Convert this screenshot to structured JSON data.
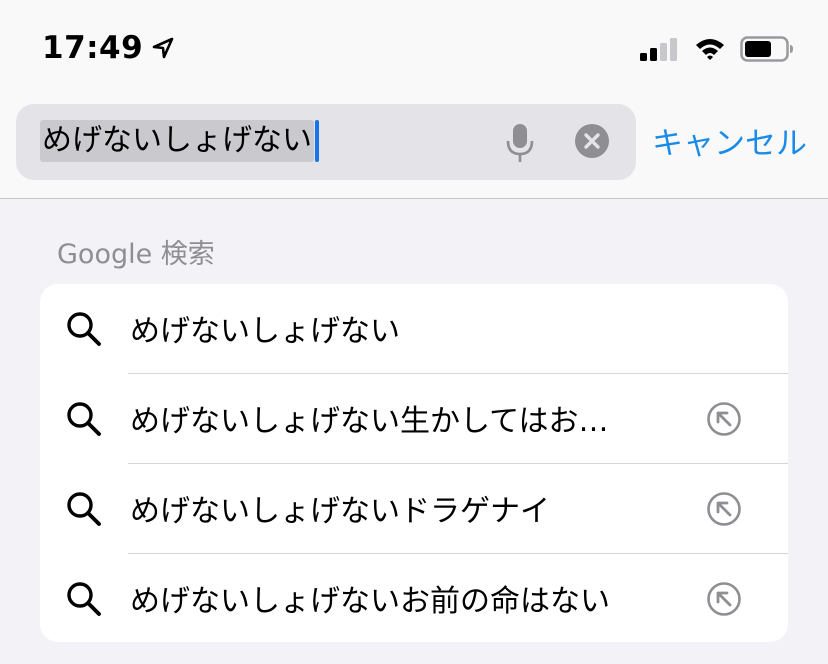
{
  "status_bar": {
    "time": "17:49"
  },
  "search": {
    "query": "めげないしょげない",
    "cancel_label": "キャンセル"
  },
  "results": {
    "section_title": "Google 検索",
    "items": [
      {
        "label": "めげないしょげない",
        "has_fill_arrow": false
      },
      {
        "label": "めげないしょげない生かしてはお…",
        "has_fill_arrow": true
      },
      {
        "label": "めげないしょげないドラゲナイ",
        "has_fill_arrow": true
      },
      {
        "label": "めげないしょげないお前の命はない",
        "has_fill_arrow": true
      }
    ]
  },
  "colors": {
    "accent": "#1a8ce8",
    "caret": "#1a73e8",
    "secondary_text": "#8e8e93"
  },
  "icons": {
    "location": "location-arrow-icon",
    "signal": "cellular-signal-icon",
    "wifi": "wifi-icon",
    "battery": "battery-icon",
    "mic": "microphone-icon",
    "clear": "clear-circle-x-icon",
    "search": "magnifying-glass-icon",
    "fill": "fill-arrow-up-left-icon"
  }
}
